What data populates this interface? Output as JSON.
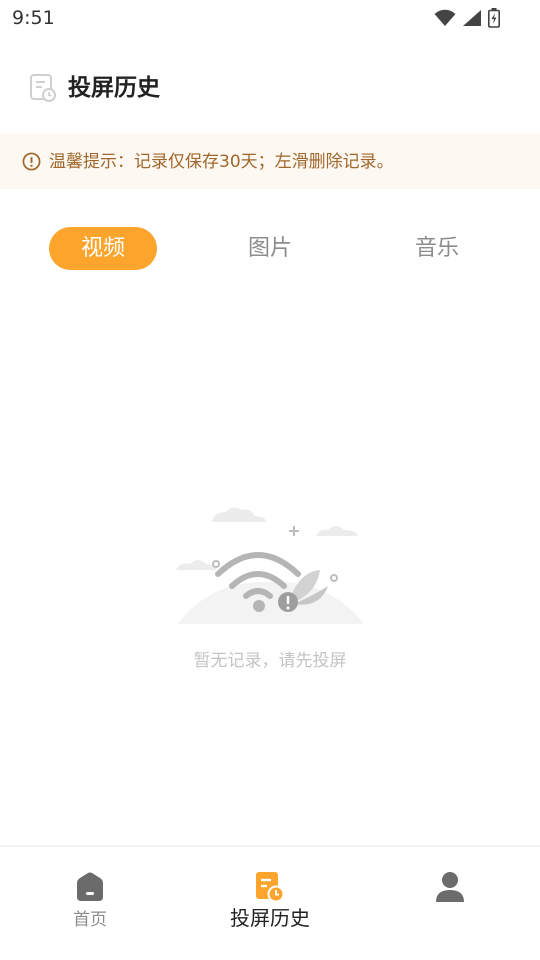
{
  "status_bar": {
    "time": "9:51"
  },
  "header": {
    "title": "投屏历史",
    "icon": "history-doc-icon"
  },
  "tip": {
    "text": "温馨提示：记录仅保存30天；左滑删除记录。",
    "icon": "info-icon"
  },
  "tabs": [
    {
      "label": "视频",
      "active": true
    },
    {
      "label": "图片",
      "active": false
    },
    {
      "label": "音乐",
      "active": false
    }
  ],
  "empty_state": {
    "text": "暂无记录，请先投屏",
    "icon": "no-connection-illustration"
  },
  "bottom_nav": [
    {
      "label": "首页",
      "icon": "home-icon",
      "active": false
    },
    {
      "label": "投屏历史",
      "icon": "history-icon",
      "active": true
    },
    {
      "label": "",
      "icon": "profile-icon",
      "active": false
    }
  ],
  "colors": {
    "accent": "#fca42c",
    "tip_bg": "#fdf8f1",
    "tip_text": "#a0662c",
    "inactive": "#8c8c8c"
  }
}
